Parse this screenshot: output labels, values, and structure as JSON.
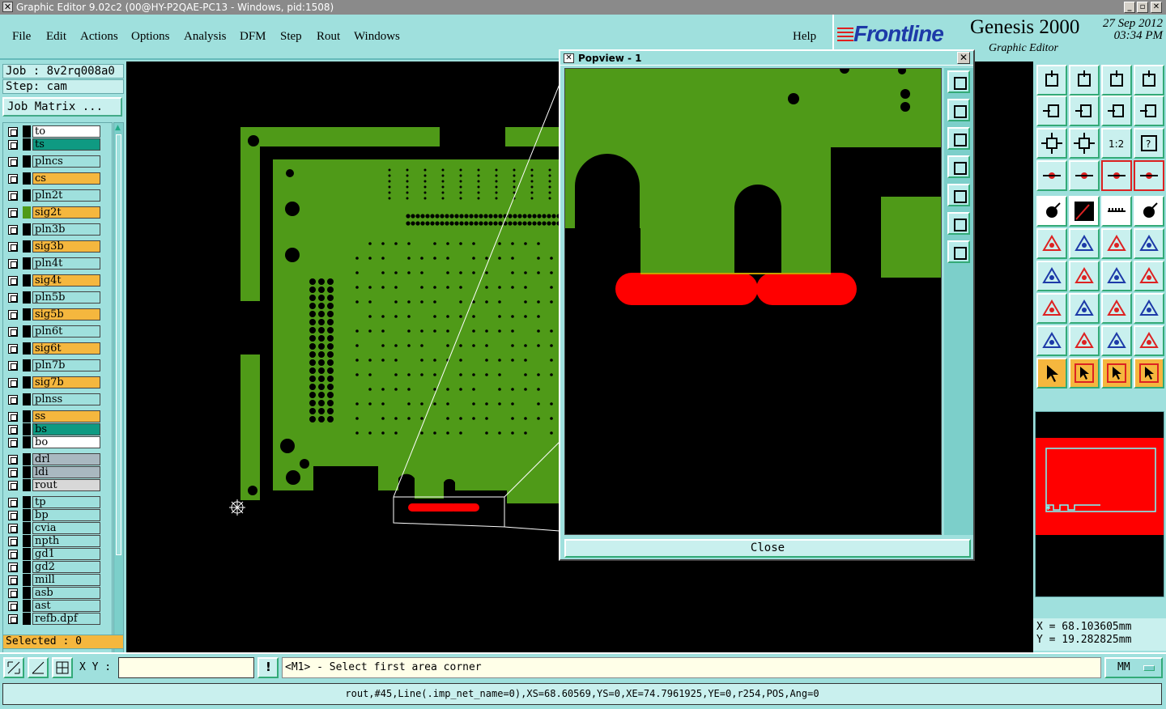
{
  "window": {
    "title": "Graphic Editor 9.02c2 (00@HY-P2QAE-PC13 - Windows, pid:1508)"
  },
  "menu": [
    "File",
    "Edit",
    "Actions",
    "Options",
    "Analysis",
    "DFM",
    "Step",
    "Rout",
    "Windows"
  ],
  "help": "Help",
  "brand": {
    "logo": "Frontline",
    "product": "Genesis 2000",
    "subtitle": "Graphic Editor",
    "date": "27 Sep 2012",
    "time": "03:34 PM"
  },
  "job": {
    "job_label": "Job : 8v2rq008a0",
    "step_label": "Step: cam",
    "matrix_button": "Job Matrix ..."
  },
  "layers": [
    {
      "name": "to",
      "color": "#ffffff",
      "swatch": "#000000"
    },
    {
      "name": "ts",
      "color": "#0f9a82",
      "swatch": "#000000"
    },
    {
      "name": "plncs",
      "color": "#9fe0dd",
      "swatch": "#000000"
    },
    {
      "name": "cs",
      "color": "#f5b73e",
      "swatch": "#000000"
    },
    {
      "name": "pln2t",
      "color": "#9fe0dd",
      "swatch": "#000000"
    },
    {
      "name": "sig2t",
      "color": "#f5b73e",
      "swatch": "#4f9a18"
    },
    {
      "name": "pln3b",
      "color": "#9fe0dd",
      "swatch": "#000000"
    },
    {
      "name": "sig3b",
      "color": "#f5b73e",
      "swatch": "#000000"
    },
    {
      "name": "pln4t",
      "color": "#9fe0dd",
      "swatch": "#000000"
    },
    {
      "name": "sig4t",
      "color": "#f5b73e",
      "swatch": "#000000"
    },
    {
      "name": "pln5b",
      "color": "#9fe0dd",
      "swatch": "#000000"
    },
    {
      "name": "sig5b",
      "color": "#f5b73e",
      "swatch": "#000000"
    },
    {
      "name": "pln6t",
      "color": "#9fe0dd",
      "swatch": "#000000"
    },
    {
      "name": "sig6t",
      "color": "#f5b73e",
      "swatch": "#000000"
    },
    {
      "name": "pln7b",
      "color": "#9fe0dd",
      "swatch": "#000000"
    },
    {
      "name": "sig7b",
      "color": "#f5b73e",
      "swatch": "#000000"
    },
    {
      "name": "plnss",
      "color": "#9fe0dd",
      "swatch": "#000000"
    },
    {
      "name": "ss",
      "color": "#f5b73e",
      "swatch": "#000000"
    },
    {
      "name": "bs",
      "color": "#0f9a82",
      "swatch": "#000000"
    },
    {
      "name": "bo",
      "color": "#ffffff",
      "swatch": "#000000"
    },
    {
      "name": "drl",
      "color": "#a9b8c0",
      "swatch": "#000000"
    },
    {
      "name": "ldi",
      "color": "#a9b8c0",
      "swatch": "#000000"
    },
    {
      "name": "rout",
      "color": "#d8d8d8",
      "swatch": "#000000"
    },
    {
      "name": "tp",
      "color": "#9fe0dd",
      "swatch": "#000000"
    },
    {
      "name": "bp",
      "color": "#9fe0dd",
      "swatch": "#000000"
    },
    {
      "name": "cvia",
      "color": "#9fe0dd",
      "swatch": "#000000"
    },
    {
      "name": "npth",
      "color": "#9fe0dd",
      "swatch": "#000000"
    },
    {
      "name": "gd1",
      "color": "#9fe0dd",
      "swatch": "#000000"
    },
    {
      "name": "gd2",
      "color": "#9fe0dd",
      "swatch": "#000000"
    },
    {
      "name": "mill",
      "color": "#9fe0dd",
      "swatch": "#000000"
    },
    {
      "name": "asb",
      "color": "#9fe0dd",
      "swatch": "#000000"
    },
    {
      "name": "ast",
      "color": "#9fe0dd",
      "swatch": "#000000"
    },
    {
      "name": "refb.dpf",
      "color": "#9fe0dd",
      "swatch": "#000000"
    }
  ],
  "selected": "Selected : 0",
  "popview": {
    "title": "Popview - 1",
    "close_label": "Close"
  },
  "coords": {
    "x": "X = 68.103605mm",
    "y": "Y = 19.282825mm"
  },
  "cmd": {
    "xy_label": "X Y :",
    "xy_value": "",
    "prompt": "<M1> - Select first area corner",
    "units": "MM"
  },
  "status": "rout,#45,Line(.imp_net_name=0),XS=68.60569,YS=0,XE=74.7961925,YE=0,r254,POS,Ang=0",
  "colors": {
    "board": "#4f9a18",
    "rout": "#ff0000",
    "panel": "#9fe0dd"
  }
}
